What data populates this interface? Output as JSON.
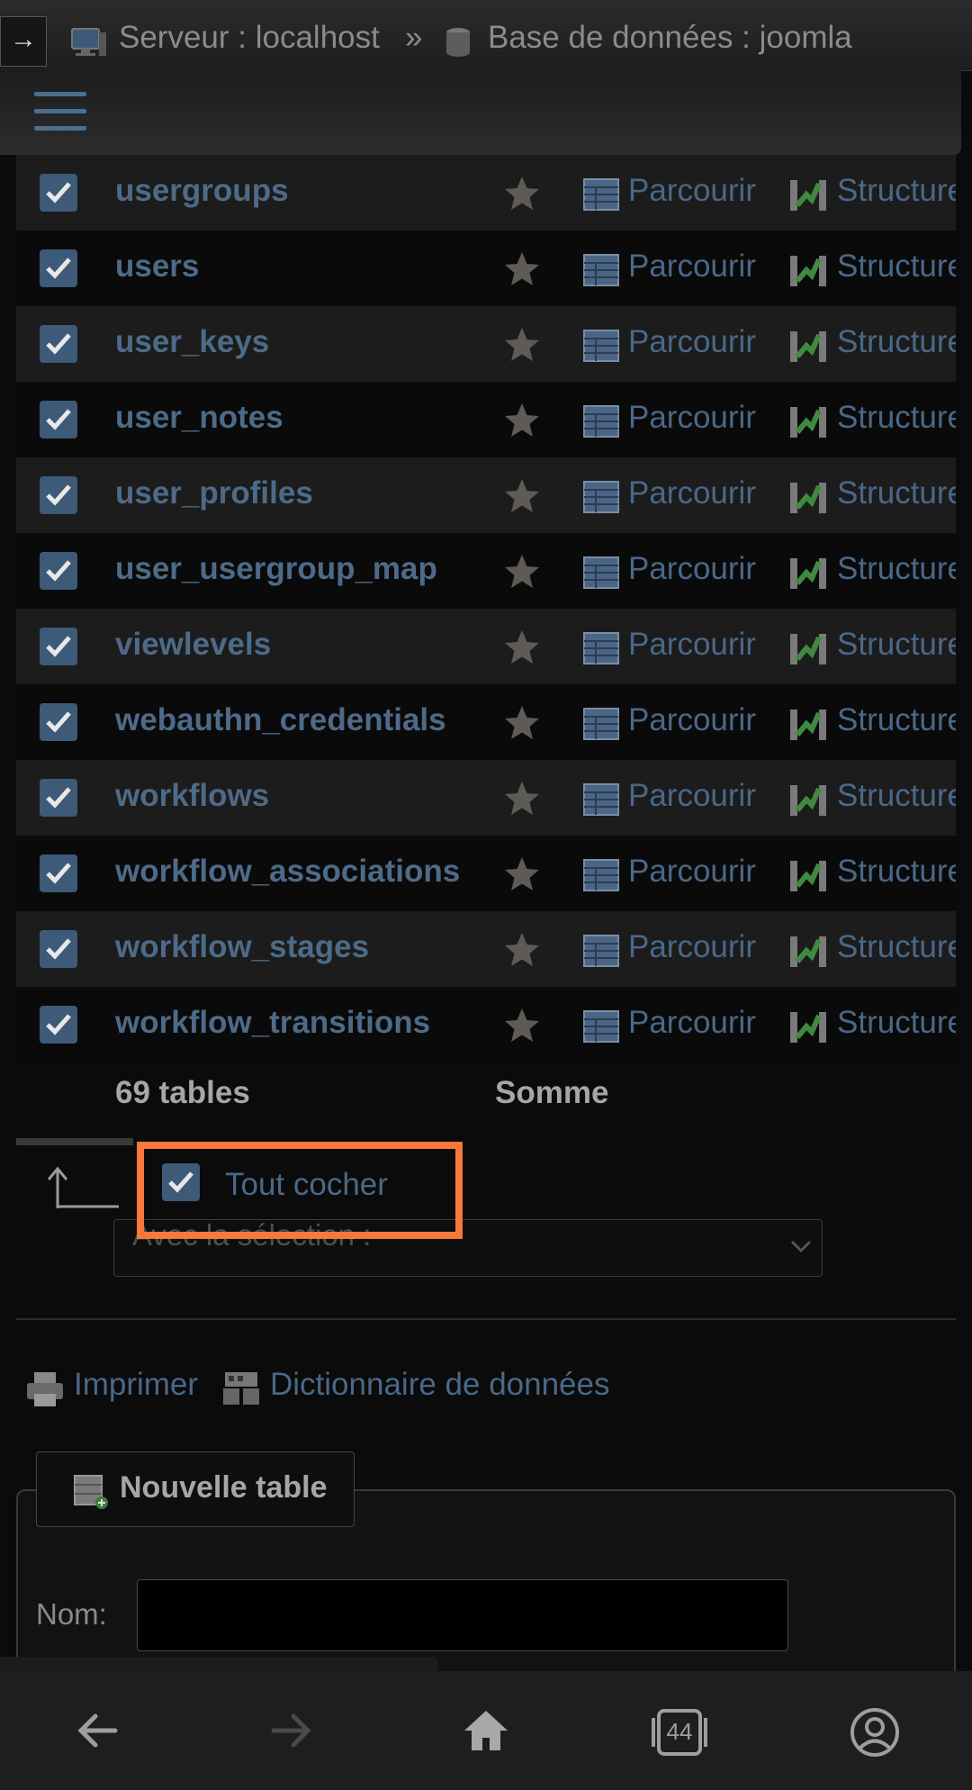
{
  "breadcrumb": {
    "toggle_glyph": "→",
    "server": "Serveur : localhost",
    "separator": "»",
    "database": "Base de données : joomla"
  },
  "tables": [
    {
      "name": "usergroups",
      "browse": "Parcourir",
      "structure": "Structure"
    },
    {
      "name": "users",
      "browse": "Parcourir",
      "structure": "Structure"
    },
    {
      "name": "user_keys",
      "browse": "Parcourir",
      "structure": "Structure"
    },
    {
      "name": "user_notes",
      "browse": "Parcourir",
      "structure": "Structure"
    },
    {
      "name": "user_profiles",
      "browse": "Parcourir",
      "structure": "Structure"
    },
    {
      "name": "user_usergroup_map",
      "browse": "Parcourir",
      "structure": "Structure"
    },
    {
      "name": "viewlevels",
      "browse": "Parcourir",
      "structure": "Structure"
    },
    {
      "name": "webauthn_credentials",
      "browse": "Parcourir",
      "structure": "Structure"
    },
    {
      "name": "workflows",
      "browse": "Parcourir",
      "structure": "Structure"
    },
    {
      "name": "workflow_associations",
      "browse": "Parcourir",
      "structure": "Structure"
    },
    {
      "name": "workflow_stages",
      "browse": "Parcourir",
      "structure": "Structure"
    },
    {
      "name": "workflow_transitions",
      "browse": "Parcourir",
      "structure": "Structure"
    }
  ],
  "summary": {
    "count": "69 tables",
    "sum": "Somme"
  },
  "check_all": {
    "label": "Tout cocher",
    "checked": true
  },
  "with_selection": {
    "placeholder": "Avec la sélection :"
  },
  "links": {
    "print": "Imprimer",
    "data_dictionary": "Dictionnaire de données"
  },
  "new_table": {
    "button_label": "Nouvelle table",
    "name_label": "Nom:",
    "name_value": ""
  },
  "nav": {
    "tabs_count": "44"
  },
  "colors": {
    "accent": "#4a6888",
    "highlight": "#f6783b",
    "checkbox": "#3d5a78"
  }
}
